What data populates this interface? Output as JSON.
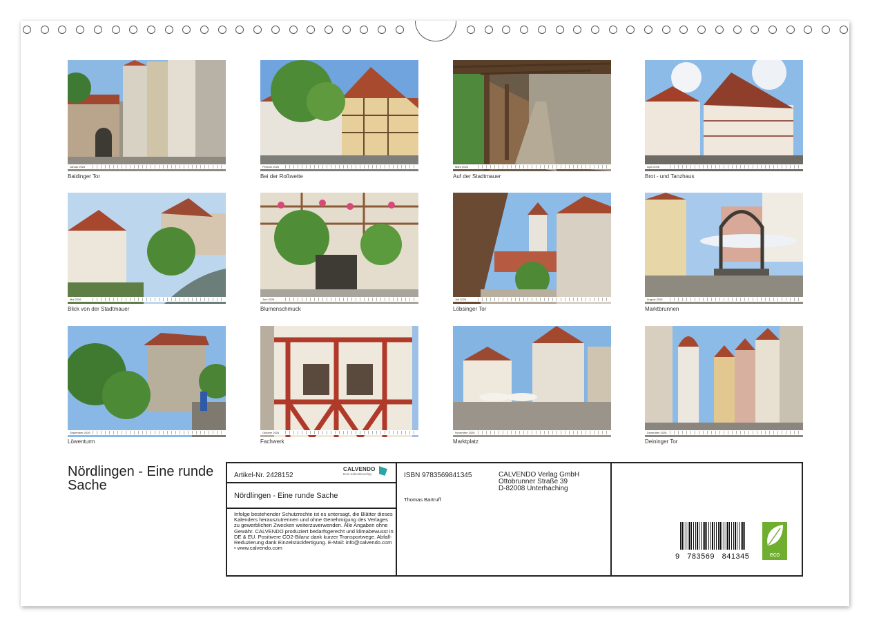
{
  "thumbnails": [
    {
      "month": "Januar 2026",
      "caption": "Baldinger Tor"
    },
    {
      "month": "Februar 2026",
      "caption": "Bei der Roßwette"
    },
    {
      "month": "März 2026",
      "caption": "Auf der Stadtmauer"
    },
    {
      "month": "April 2026",
      "caption": "Brot - und Tanzhaus"
    },
    {
      "month": "Mai 2026",
      "caption": "Blick von der Stadtmauer"
    },
    {
      "month": "Juni 2026",
      "caption": "Blumenschmuck"
    },
    {
      "month": "Juli 2026",
      "caption": "Löbsinger Tor"
    },
    {
      "month": "August 2026",
      "caption": "Marktbrunnen"
    },
    {
      "month": "September 2026",
      "caption": "Löwenturm"
    },
    {
      "month": "Oktober 2026",
      "caption": "Fachwerk"
    },
    {
      "month": "November 2026",
      "caption": "Marktplatz"
    },
    {
      "month": "Dezember 2026",
      "caption": "Deininger  Tor"
    }
  ],
  "main_title": "Nördlingen - Eine runde Sache",
  "info": {
    "article": "Artikel-Nr. 2428152",
    "brand": "CALVENDO",
    "brand_sub": "Dein Kalenderverlag",
    "title": "Nördlingen - Eine runde Sache",
    "legal": "Infolge bestehender Schutzrechte ist es untersagt, die Blätter dieses Kalenders herauszutrennen und ohne Genehmigung des Verlages zu gewerblichen Zwecken weiterzuverwenden. Alle Angaben ohne Gewähr. CALVENDO produziert bedarfsgerecht und klimabewusst in DE & EU. Positivere CO2-Bilanz dank kurzer Transportwege. Abfall-Reduzierung dank Einzelstückfertigung. E-Mail: info@calvendo.com • www.calvendo.com",
    "isbn": "ISBN 9783569841345",
    "author": "Thomas Bartruff",
    "publisher": [
      "CALVENDO Verlag GmbH",
      "Ottobrunner Straße 39",
      "D-82008 Unterhaching"
    ],
    "barcode_digits": "9   783569   841345",
    "eco_label": "eco"
  },
  "colors": {
    "frame": "#222222",
    "eco_green": "#6fae2e",
    "sky": "#7fb2e0"
  }
}
